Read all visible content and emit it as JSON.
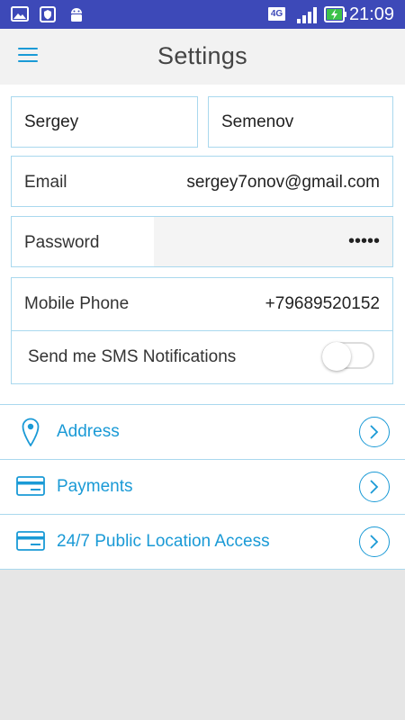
{
  "status_bar": {
    "time": "21:09",
    "network": "4G",
    "icons": [
      "image-icon",
      "shield-icon",
      "android-icon",
      "signal-icon",
      "battery-charging-icon"
    ]
  },
  "header": {
    "title": "Settings",
    "menu_icon": "hamburger-menu-icon"
  },
  "profile": {
    "first_name": "Sergey",
    "last_name": "Semenov",
    "email_label": "Email",
    "email_value": "sergey7onov@gmail.com",
    "password_label": "Password",
    "password_value": "•••••",
    "phone_label": "Mobile Phone",
    "phone_value": "+79689520152",
    "sms_label": "Send me SMS Notifications",
    "sms_enabled": false
  },
  "nav": {
    "items": [
      {
        "label": "Address",
        "icon": "location-pin-icon"
      },
      {
        "label": "Payments",
        "icon": "credit-card-icon"
      },
      {
        "label": "24/7 Public Location Access",
        "icon": "credit-card-icon"
      }
    ]
  },
  "colors": {
    "status_bar": "#3d49b8",
    "accent": "#1a9ad6",
    "border": "#a9d8ee",
    "background": "#e6e6e6"
  }
}
